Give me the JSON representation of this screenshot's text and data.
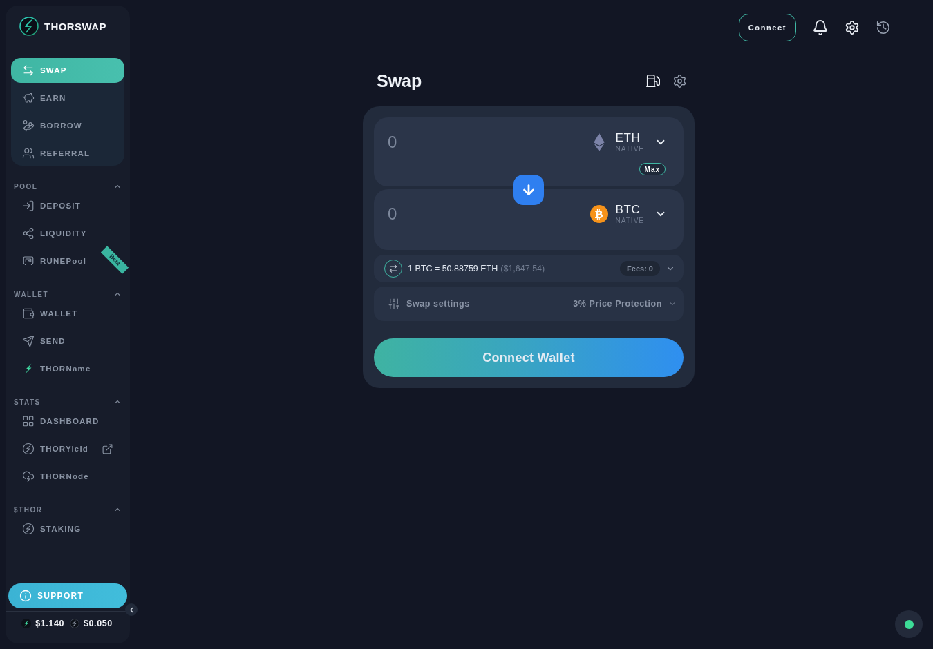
{
  "brand": {
    "name": "THORSWAP"
  },
  "sidebar": {
    "main_items": [
      {
        "label": "SWAP",
        "selected": true
      },
      {
        "label": "EARN",
        "selected": false
      },
      {
        "label": "BORROW",
        "selected": false
      },
      {
        "label": "REFERRAL",
        "selected": false
      }
    ],
    "sections": [
      {
        "title": "POOL",
        "expanded": true,
        "items": [
          {
            "label": "DEPOSIT",
            "selected": false,
            "external": false
          },
          {
            "label": "LIQUIDITY",
            "selected": false,
            "external": false
          },
          {
            "label": "RUNEPool",
            "selected": false,
            "external": false,
            "badge": "Beta"
          }
        ]
      },
      {
        "title": "WALLET",
        "expanded": true,
        "items": [
          {
            "label": "WALLET",
            "selected": false,
            "external": false
          },
          {
            "label": "SEND",
            "selected": false,
            "external": false
          },
          {
            "label": "THORName",
            "selected": false,
            "external": false
          }
        ]
      },
      {
        "title": "STATS",
        "expanded": true,
        "items": [
          {
            "label": "DASHBOARD",
            "selected": false,
            "external": false
          },
          {
            "label": "THORYield",
            "selected": false,
            "external": true
          },
          {
            "label": "THORNode",
            "selected": false,
            "external": false
          }
        ]
      },
      {
        "title": "$THOR",
        "expanded": true,
        "items": [
          {
            "label": "STAKING",
            "selected": false,
            "external": false
          }
        ]
      }
    ],
    "support": {
      "label": "SUPPORT"
    },
    "prices": [
      {
        "value": "$1.140"
      },
      {
        "value": "$0.050"
      }
    ]
  },
  "header": {
    "connect_button": "Connect"
  },
  "swap": {
    "title": "Swap",
    "input": {
      "placeholder": "0",
      "symbol": "ETH",
      "network": "NATIVE",
      "max_button": "Max"
    },
    "output": {
      "placeholder": "0",
      "symbol": "BTC",
      "network": "NATIVE"
    },
    "rate": {
      "text": "1 BTC = 50.88759 ETH",
      "usd": "($1,647 54)",
      "fees": "Fees: 0"
    },
    "settings": {
      "label": "Swap settings",
      "value": "3% Price Protection"
    },
    "action_button": "Connect Wallet"
  },
  "status": {
    "color": "#3ddc97"
  }
}
